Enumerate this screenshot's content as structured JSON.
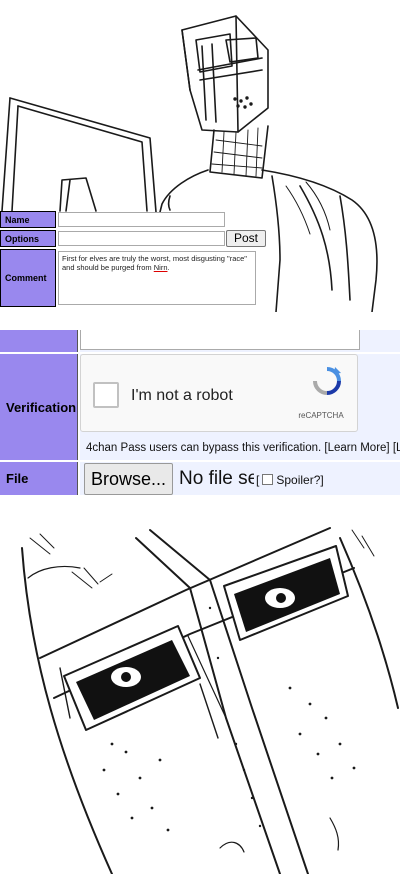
{
  "panel1": {
    "name_label": "Name",
    "options_label": "Options",
    "comment_label": "Comment",
    "post_button": "Post",
    "comment_text": "First for elves are truly the worst, most disgusting \"race\" and should be purged from ",
    "comment_text_end": "Nirn",
    "comment_text_tail": "."
  },
  "panel2": {
    "verification_label": "Verification",
    "captcha_text": "I'm not a robot",
    "captcha_brand": "reCAPTCHA",
    "pass_notice": "4chan Pass users can bypass this verification. [Learn More] [L",
    "file_label": "File",
    "browse_button": "Browse...",
    "no_file_text": "No file sel",
    "spoiler_label": "Spoiler?"
  }
}
